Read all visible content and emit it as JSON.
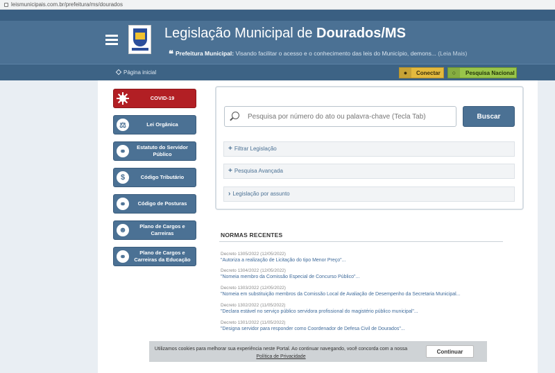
{
  "browser": {
    "url": "leismunicipais.com.br/prefeitura/ms/dourados"
  },
  "header": {
    "title_prefix": "Legislação Municipal de ",
    "title_city": "Dourados/MS",
    "subtitle_label": "Prefeitura Municipal:",
    "subtitle_text": " Visando facilitar o acesso e o conhecimento das leis do Município, demons...",
    "subtitle_more": " (Leia Mais)",
    "quote_glyph": "❝"
  },
  "nav": {
    "home": "Página inicial",
    "conectar": "Conectar",
    "pesquisa_nacional": "Pesquisa Nacional"
  },
  "sidebar": {
    "items": [
      {
        "label": "COVID-19",
        "icon": "virus-icon",
        "color": "#b21f24"
      },
      {
        "label": "Lei Orgânica",
        "icon": "gavel-icon",
        "color": "#4b7194"
      },
      {
        "label": "Estatuto do Servidor Público",
        "icon": "users-icon",
        "color": "#4b7194"
      },
      {
        "label": "Código Tributário",
        "icon": "dollar-icon",
        "color": "#4b7194"
      },
      {
        "label": "Código de Posturas",
        "icon": "users-icon",
        "color": "#4b7194"
      },
      {
        "label": "Plano de Cargos e Carreiras",
        "icon": "group-icon",
        "color": "#4b7194"
      },
      {
        "label": "Plano de Cargos e Carreiras da Educação",
        "icon": "users-icon",
        "color": "#4b7194"
      }
    ]
  },
  "search": {
    "placeholder": "Pesquisa por número do ato ou palavra-chave (Tecla Tab)",
    "button": "Buscar",
    "filters": [
      {
        "symbol": "+",
        "label": "Filtrar Legislação"
      },
      {
        "symbol": "+",
        "label": "Pesquisa Avançada"
      },
      {
        "symbol": "›",
        "label": "Legislação por assunto"
      }
    ]
  },
  "normas": {
    "title": "NORMAS RECENTES",
    "items": [
      {
        "meta": "Decreto 1305/2022 (12/05/2022)",
        "text": "\"Autoriza a realização de Licitação do tipo Menor Preço\"..."
      },
      {
        "meta": "Decreto 1304/2022 (12/05/2022)",
        "text": "\"Nomeia membro da Comissão Especial de Concurso Público\"..."
      },
      {
        "meta": "Decreto 1303/2022 (12/05/2022)",
        "text": "\"Nomeia em substituição membros da Comissão Local de Avaliação de Desempenho da Secretaria Municipal..."
      },
      {
        "meta": "Decreto 1302/2022 (11/05/2022)",
        "text": "\"Declara estável no serviço público servidora profissional do magistério público municipal\"..."
      },
      {
        "meta": "Decreto 1301/2022 (11/05/2022)",
        "text": "\"Designa servidor para responder como Coordenador de Defesa Civil de Dourados\"..."
      }
    ]
  },
  "cookie": {
    "text": "Utilizamos cookies para melhorar sua experiência neste Portal. Ao continuar navegando, você concorda com a nossa ",
    "policy_link": "Política de Privacidade",
    "button": "Continuar"
  },
  "colors": {
    "brand": "#4b7194",
    "covid": "#b21f24",
    "conectar": "#e3ba3e",
    "pesquisa": "#99c54a"
  }
}
